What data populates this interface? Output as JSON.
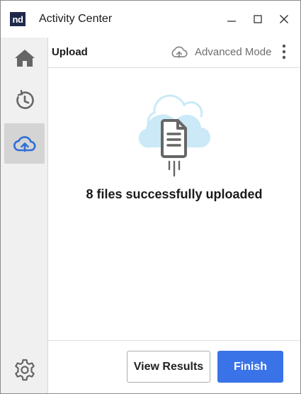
{
  "window": {
    "logo_text": "nd",
    "title": "Activity Center"
  },
  "sidebar": {
    "items": [
      {
        "icon": "home-icon",
        "active": false
      },
      {
        "icon": "history-icon",
        "active": false
      },
      {
        "icon": "cloud-upload-icon",
        "active": true
      },
      {
        "icon": "gear-icon",
        "active": false
      }
    ]
  },
  "header": {
    "title": "Upload",
    "advanced_mode_label": "Advanced Mode"
  },
  "main": {
    "status_message": "8 files successfully uploaded"
  },
  "footer": {
    "view_results_label": "View Results",
    "finish_label": "Finish"
  },
  "colors": {
    "accent": "#3a73e8",
    "active_icon": "#2e6fd6",
    "cloud_light": "#cbe9f7",
    "icon_gray": "#666666"
  }
}
